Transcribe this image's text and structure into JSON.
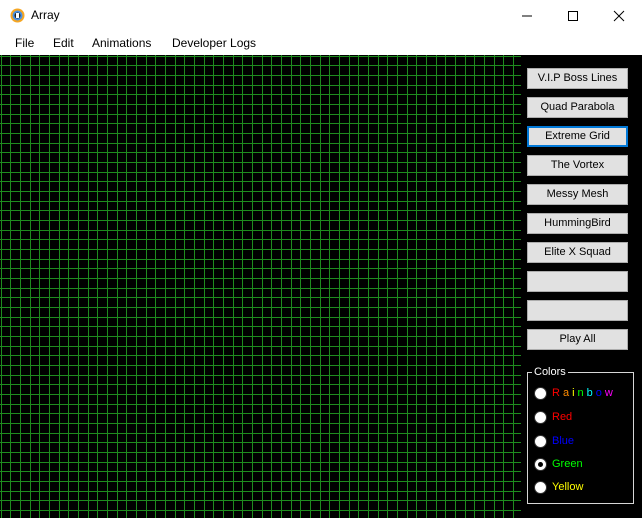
{
  "window": {
    "title": "Array",
    "icon": "app-icon",
    "controls": [
      "minimize-icon",
      "maximize-icon",
      "close-icon"
    ]
  },
  "menu": {
    "items": [
      "File",
      "Edit",
      "Animations",
      "Developer Logs"
    ]
  },
  "canvas": {
    "background": "#000000",
    "grid_color": "#1e8b1e"
  },
  "buttons": [
    {
      "label": "V.I.P Boss Lines"
    },
    {
      "label": "Quad Parabola"
    },
    {
      "label": "Extreme Grid",
      "focused": true
    },
    {
      "label": "The Vortex"
    },
    {
      "label": "Messy Mesh"
    },
    {
      "label": "HummingBird"
    },
    {
      "label": "Elite X Squad"
    },
    {
      "label": ""
    },
    {
      "label": ""
    },
    {
      "label": "Play All"
    }
  ],
  "colors_group": {
    "title": "Colors",
    "options": [
      {
        "label": "Rainbow",
        "color": "rainbow",
        "selected": false
      },
      {
        "label": "Red",
        "color": "#ff0000",
        "selected": false
      },
      {
        "label": "Blue",
        "color": "#0000ff",
        "selected": false
      },
      {
        "label": "Green",
        "color": "#00ff00",
        "selected": true
      },
      {
        "label": "Yellow",
        "color": "#ffff00",
        "selected": false
      }
    ],
    "rainbow_colors": [
      "#ff0000",
      "#ff8c00",
      "#ffff00",
      "#00ff00",
      "#00ffff",
      "#0000ff",
      "#ff00ff"
    ]
  }
}
